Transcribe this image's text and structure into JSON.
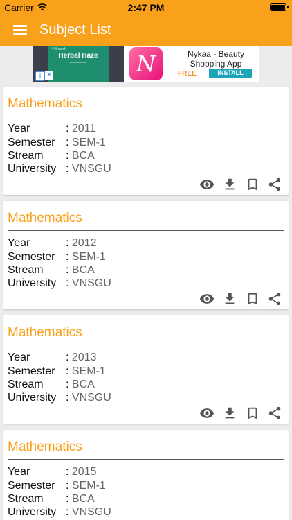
{
  "status_bar": {
    "carrier": "Carrier",
    "time": "2:47 PM"
  },
  "navbar": {
    "title": "Subject List",
    "menu_icon": "hamburger-menu-icon"
  },
  "ad": {
    "phone_headline": "Herbal Haze",
    "app_name": "Nykaa - Beauty Shopping App",
    "free_label": "FREE",
    "install_label": "INSTALL",
    "info_icon": "info-icon",
    "close_icon": "close-icon"
  },
  "labels": {
    "year": "Year",
    "semester": "Semester",
    "stream": "Stream",
    "university": "University",
    "sep": ": "
  },
  "cards": [
    {
      "subject": "Mathematics",
      "year": "2011",
      "semester": "SEM-1",
      "stream": "BCA",
      "university": "VNSGU"
    },
    {
      "subject": "Mathematics",
      "year": "2012",
      "semester": "SEM-1",
      "stream": "BCA",
      "university": "VNSGU"
    },
    {
      "subject": "Mathematics",
      "year": "2013",
      "semester": "SEM-1",
      "stream": "BCA",
      "university": "VNSGU"
    },
    {
      "subject": "Mathematics",
      "year": "2015",
      "semester": "SEM-1",
      "stream": "BCA",
      "university": "VNSGU"
    }
  ],
  "action_icons": [
    "eye-icon",
    "download-icon",
    "bookmark-icon",
    "share-icon"
  ],
  "colors": {
    "accent": "#f9a11b",
    "icon": "#555555",
    "background": "#ececec"
  }
}
